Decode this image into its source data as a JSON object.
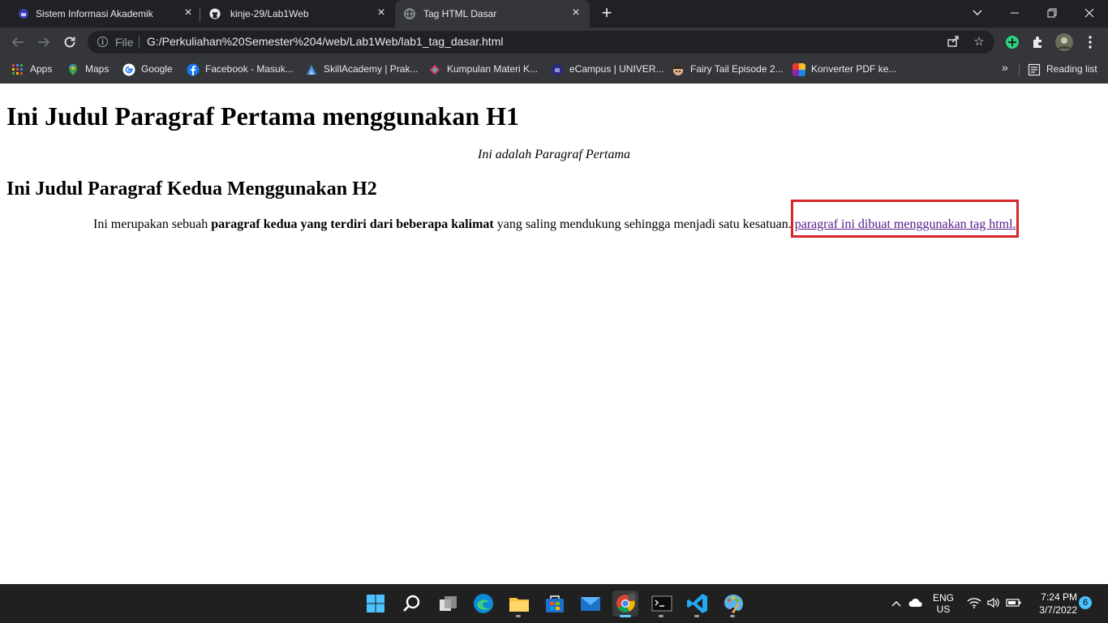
{
  "browser": {
    "tabs": [
      {
        "title": "Sistem Informasi Akademik",
        "icon": "university-icon",
        "active": false
      },
      {
        "title": "kinje-29/Lab1Web",
        "icon": "github-icon",
        "active": false
      },
      {
        "title": "Tag HTML Dasar",
        "icon": "globe-icon",
        "active": true
      }
    ],
    "omnibox": {
      "scheme_label": "File",
      "url": "G:/Perkuliahan%20Semester%204/web/Lab1Web/lab1_tag_dasar.html"
    },
    "bookmarks": [
      {
        "label": "Apps",
        "icon": "apps-grid-icon"
      },
      {
        "label": "Maps",
        "icon": "maps-pin-icon"
      },
      {
        "label": "Google",
        "icon": "google-icon"
      },
      {
        "label": "Facebook - Masuk...",
        "icon": "facebook-icon"
      },
      {
        "label": "SkillAcademy | Prak...",
        "icon": "skillacademy-icon"
      },
      {
        "label": "Kumpulan Materi K...",
        "icon": "materi-icon"
      },
      {
        "label": "eCampus | UNIVER...",
        "icon": "ecampus-icon"
      },
      {
        "label": "Fairy Tail Episode 2...",
        "icon": "fairytail-icon"
      },
      {
        "label": "Konverter PDF ke...",
        "icon": "pdf-converter-icon"
      }
    ],
    "bookmarks_overflow": "»",
    "reading_list": "Reading list"
  },
  "page": {
    "h1": "Ini Judul Paragraf Pertama menggunakan H1",
    "p1": "Ini adalah Paragraf Pertama",
    "h2": "Ini Judul Paragraf Kedua Menggunakan H2",
    "p2_start": "Ini merupakan sebuah ",
    "p2_bold": "paragraf kedua yang terdiri dari beberapa kalimat",
    "p2_mid": " yang saling mendukung sehingga menjadi satu kesatuan. ",
    "p2_link": "paragraf ini dibuat menggunakan tag html.",
    "highlight_color": "#d9252a",
    "link_color": "#551a8b"
  },
  "taskbar": {
    "apps": [
      "windows-start-icon",
      "search-icon",
      "task-view-icon",
      "edge-icon",
      "file-explorer-icon",
      "store-icon",
      "mail-icon",
      "chrome-icon",
      "terminal-icon",
      "vscode-icon",
      "paint-icon"
    ],
    "lang_top": "ENG",
    "lang_bottom": "US",
    "time": "7:24 PM",
    "date": "3/7/2022",
    "notifications": "6"
  }
}
